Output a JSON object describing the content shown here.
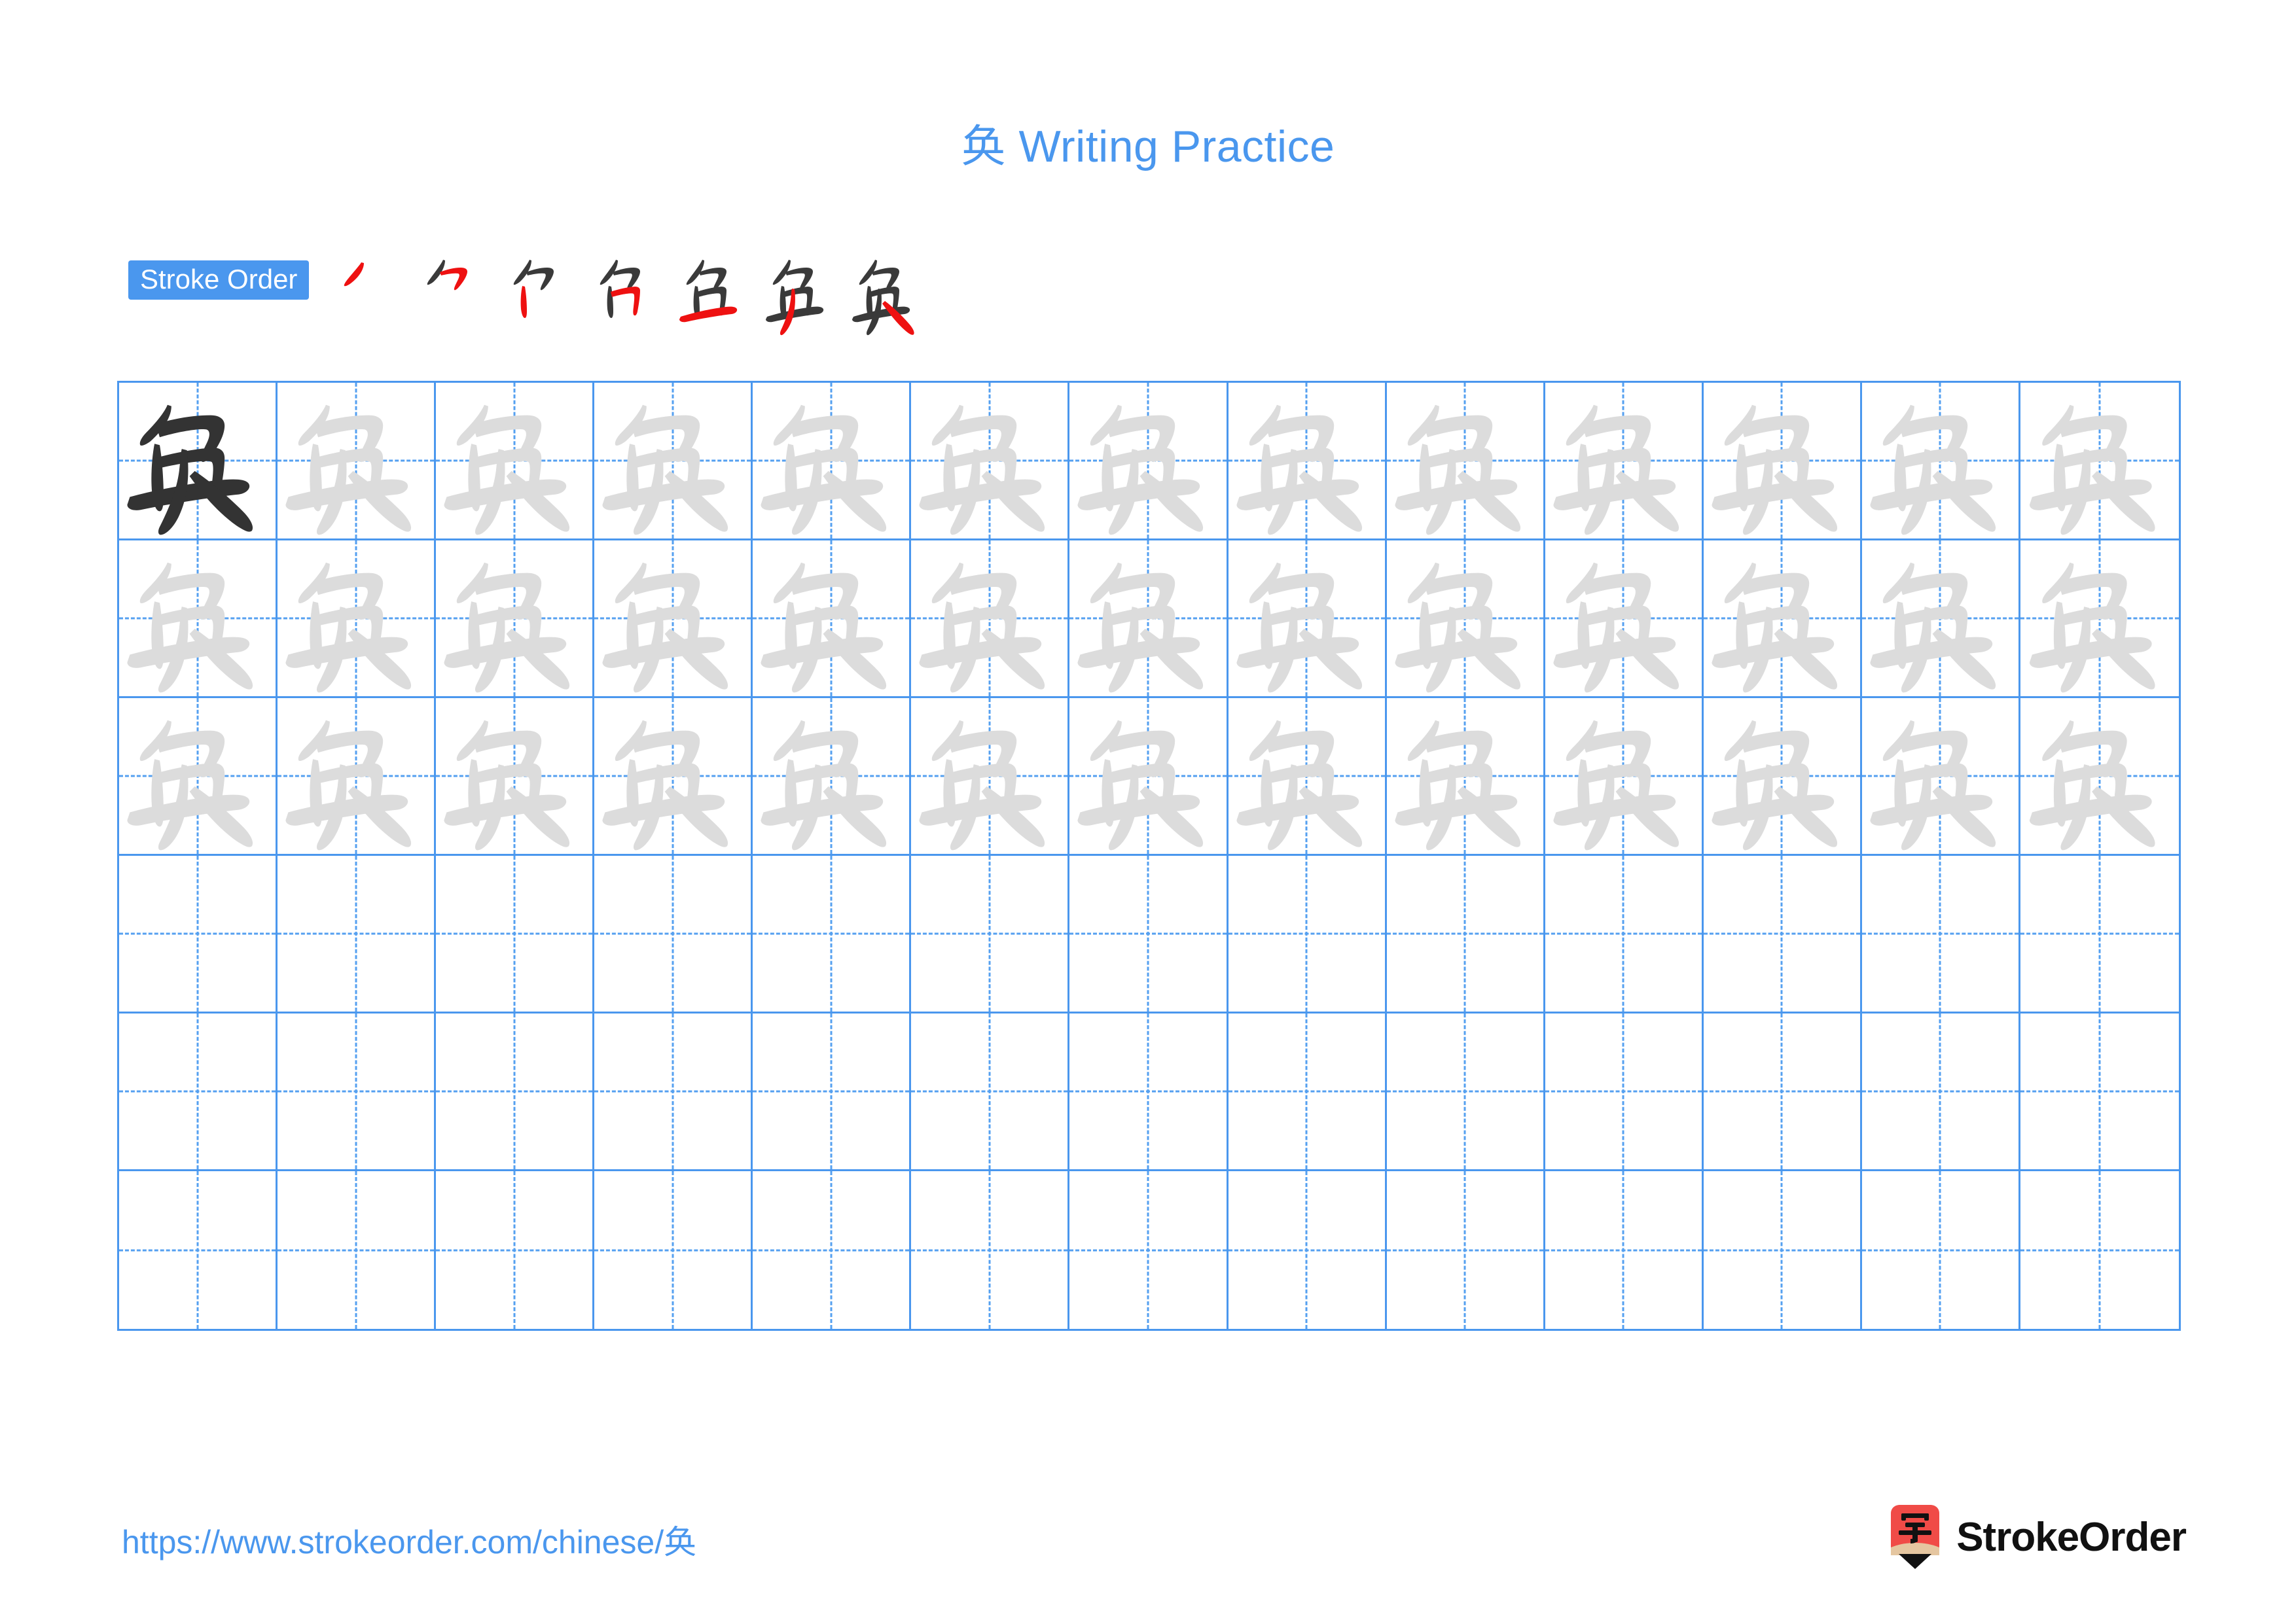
{
  "character": "奂",
  "title": "奂 Writing Practice",
  "colors": {
    "accent_blue": "#4a97ee",
    "grid_line": "#4a97ee",
    "grid_dash": "#55a0f0",
    "trace_gray": "#dcdcdc",
    "ink_black": "#333333",
    "new_stroke_red": "#ee1111",
    "logo_red": "#f04b47",
    "logo_wood": "#e5c6a0",
    "background": "#ffffff"
  },
  "stroke_order": {
    "badge_label": "Stroke Order",
    "total_strokes": 7,
    "steps": [
      {
        "index": 1,
        "stroke_name": "pie",
        "new_stroke_color": "#ee1111"
      },
      {
        "index": 2,
        "stroke_name": "heng-pie-wan-gou",
        "new_stroke_color": "#ee1111"
      },
      {
        "index": 3,
        "stroke_name": "shu",
        "new_stroke_color": "#ee1111"
      },
      {
        "index": 4,
        "stroke_name": "heng-zhe",
        "new_stroke_color": "#ee1111"
      },
      {
        "index": 5,
        "stroke_name": "heng",
        "new_stroke_color": "#ee1111"
      },
      {
        "index": 6,
        "stroke_name": "pie-left-falling",
        "new_stroke_color": "#ee1111"
      },
      {
        "index": 7,
        "stroke_name": "na-right-falling",
        "new_stroke_color": "#ee1111"
      }
    ]
  },
  "practice_grid": {
    "columns": 13,
    "rows": 6,
    "model_cell": {
      "row": 1,
      "column": 1,
      "style": "ink"
    },
    "traced_rows": [
      1,
      2,
      3
    ],
    "blank_rows": [
      4,
      5,
      6
    ]
  },
  "footer": {
    "url": "https://www.strokeorder.com/chinese/奂",
    "brand_name": "StrokeOrder",
    "brand_icon_glyph": "字"
  }
}
